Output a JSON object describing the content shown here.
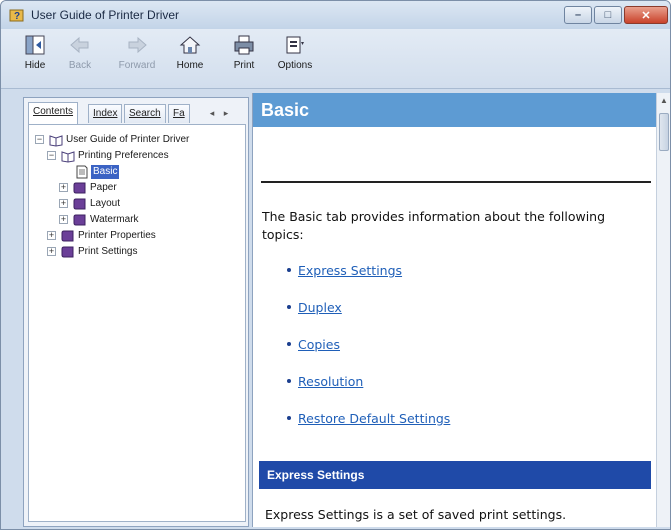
{
  "window": {
    "title": "User Guide of Printer Driver",
    "controls": {
      "minimize": "–",
      "maximize": "□",
      "close": "✕"
    }
  },
  "toolbar": {
    "buttons": [
      {
        "label": "Hide",
        "icon": "hide-icon",
        "enabled": true
      },
      {
        "label": "Back",
        "icon": "back-arrow-icon",
        "enabled": false
      },
      {
        "label": "Forward",
        "icon": "forward-arrow-icon",
        "enabled": false
      },
      {
        "label": "Home",
        "icon": "home-icon",
        "enabled": true
      },
      {
        "label": "Print",
        "icon": "printer-icon",
        "enabled": true
      },
      {
        "label": "Options",
        "icon": "options-icon",
        "enabled": true
      }
    ]
  },
  "nav": {
    "tabs": [
      "Contents",
      "Index",
      "Search",
      "Fa"
    ],
    "active_tab": "Contents",
    "tree": [
      {
        "label": "User Guide of Printer Driver",
        "expander": "−",
        "icon": "open-book-icon"
      },
      {
        "label": "Printing Preferences",
        "expander": "−",
        "icon": "open-book-icon"
      },
      {
        "label": "Basic",
        "icon": "page-icon",
        "selected": true
      },
      {
        "label": "Paper",
        "expander": "+",
        "icon": "closed-book-icon"
      },
      {
        "label": "Layout",
        "expander": "+",
        "icon": "closed-book-icon"
      },
      {
        "label": "Watermark",
        "expander": "+",
        "icon": "closed-book-icon"
      },
      {
        "label": "Printer Properties",
        "expander": "+",
        "icon": "closed-book-icon"
      },
      {
        "label": "Print Settings",
        "expander": "+",
        "icon": "closed-book-icon"
      }
    ]
  },
  "content": {
    "title": "Basic",
    "intro": "The Basic tab provides information about the following topics:",
    "links": [
      "Express Settings",
      "Duplex",
      "Copies",
      "Resolution",
      "Restore Default Settings"
    ],
    "section_title": "Express Settings",
    "section_text": "Express Settings is a set of saved print settings."
  },
  "colors": {
    "header_blue": "#5d9bd3",
    "section_blue": "#1f4aa8",
    "link_blue": "#1f5fb8",
    "selection": "#3b63c4"
  }
}
